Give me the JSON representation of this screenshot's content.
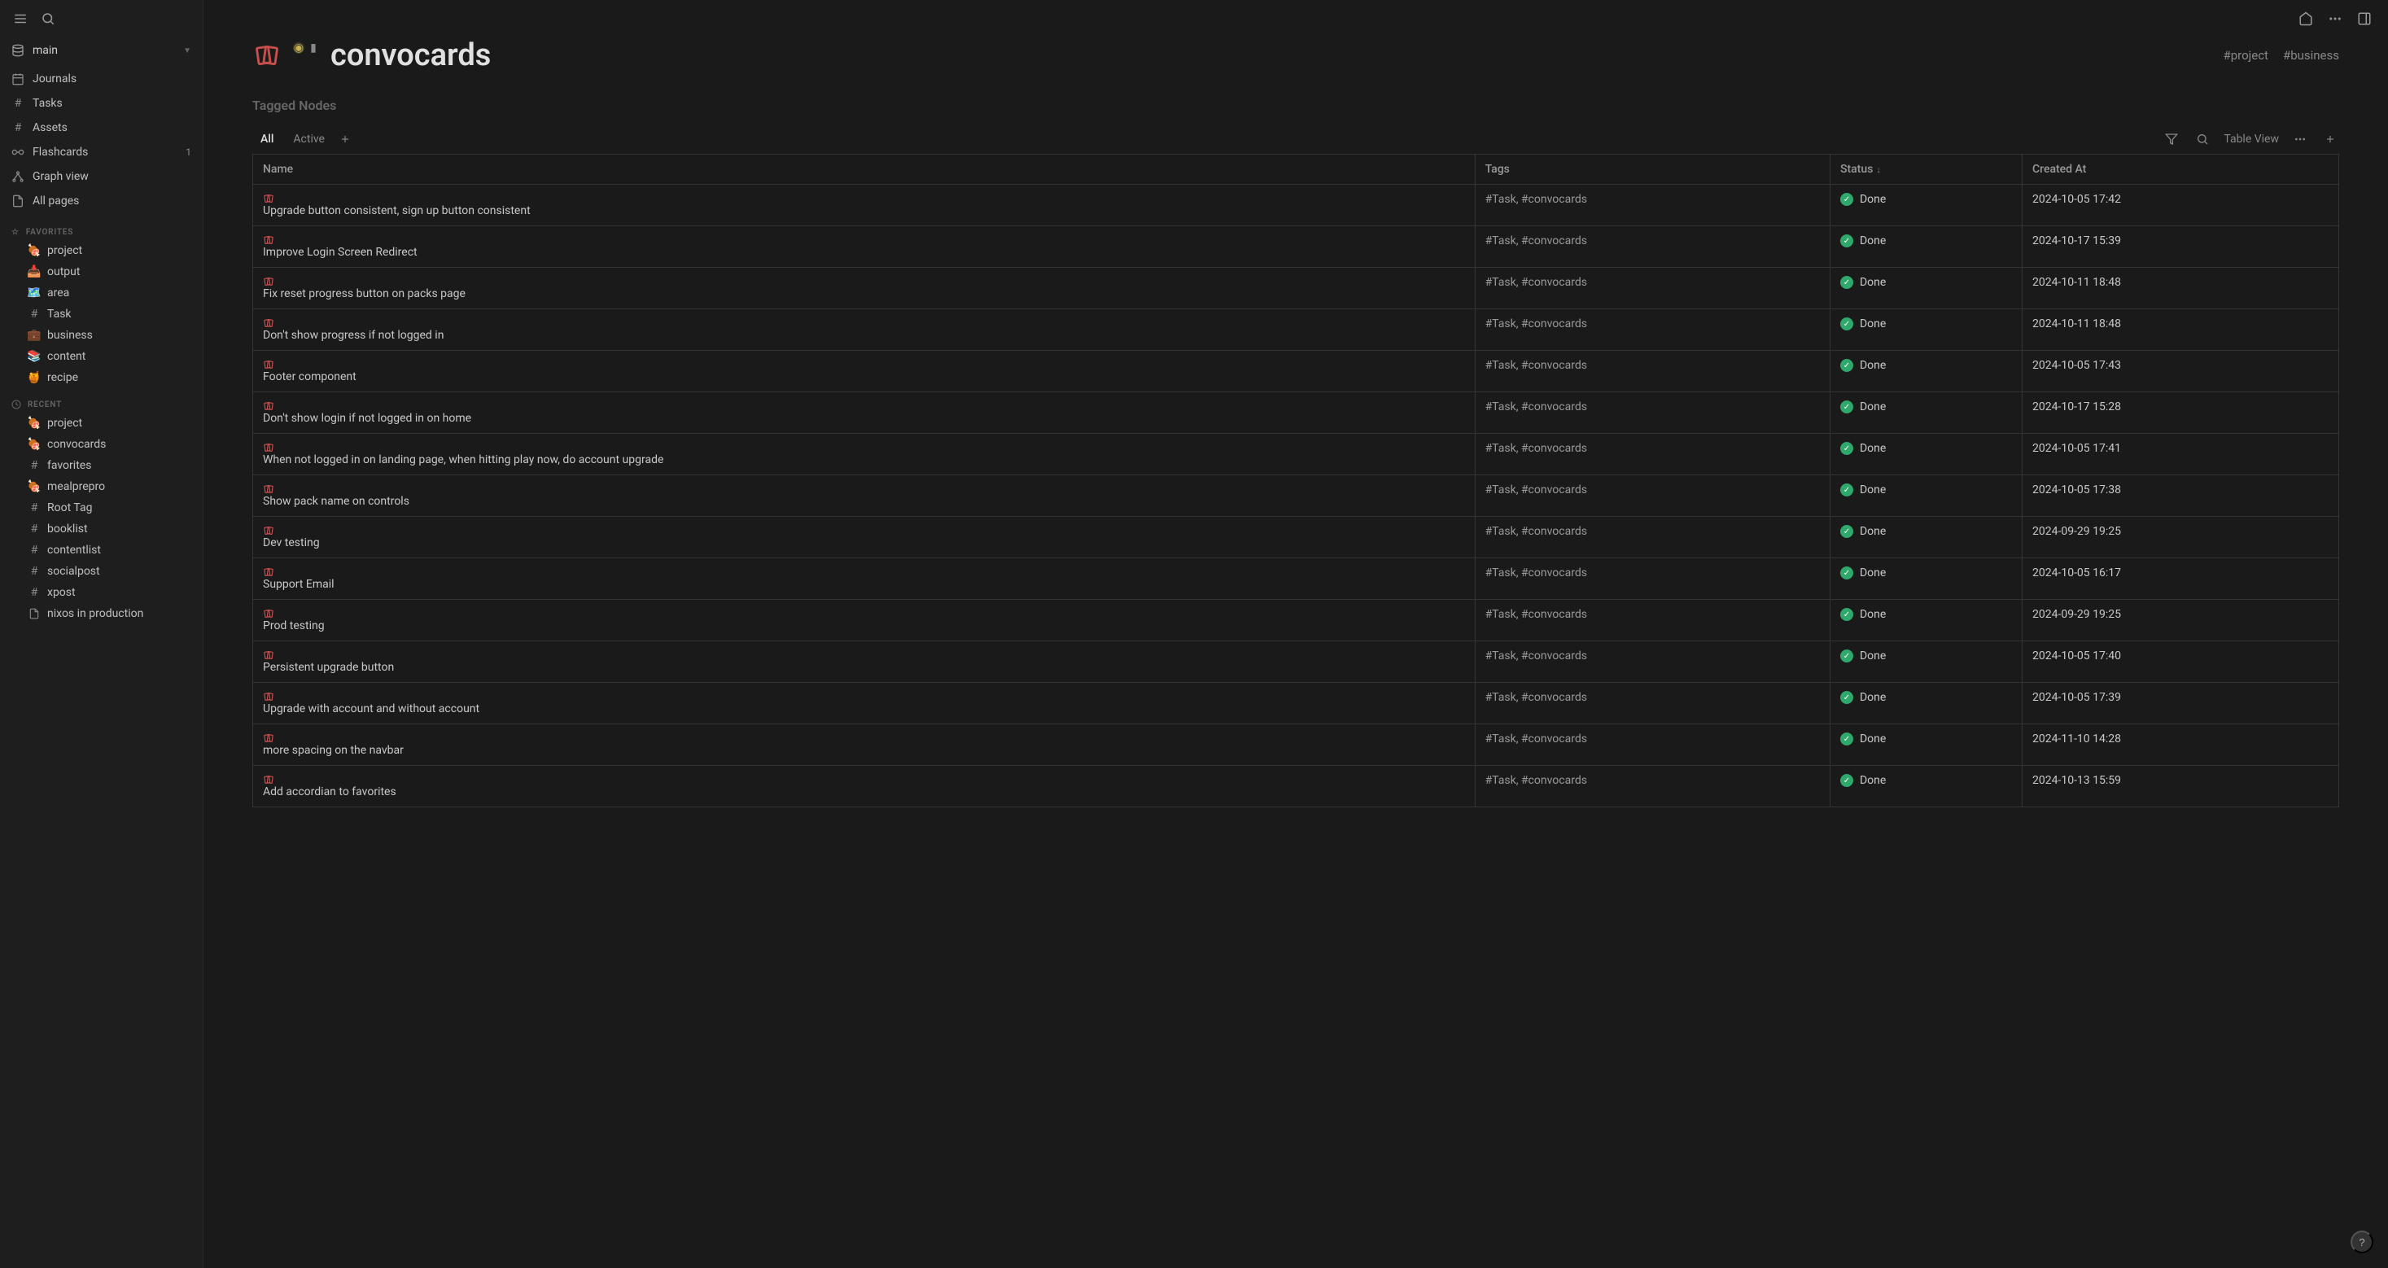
{
  "workspace": {
    "name": "main"
  },
  "nav": {
    "journals": "Journals",
    "tasks": "Tasks",
    "assets": "Assets",
    "flashcards": "Flashcards",
    "flashcards_count": "1",
    "graph": "Graph view",
    "all_pages": "All pages"
  },
  "favorites": {
    "label": "FAVORITES",
    "items": [
      {
        "icon": "meat",
        "label": "project"
      },
      {
        "icon": "inbox",
        "label": "output"
      },
      {
        "icon": "map",
        "label": "area"
      },
      {
        "icon": "hash",
        "label": "Task"
      },
      {
        "icon": "briefcase",
        "label": "business"
      },
      {
        "icon": "books",
        "label": "content"
      },
      {
        "icon": "honey",
        "label": "recipe"
      }
    ]
  },
  "recent": {
    "label": "RECENT",
    "items": [
      {
        "icon": "meat",
        "label": "project"
      },
      {
        "icon": "meat",
        "label": "convocards"
      },
      {
        "icon": "hash",
        "label": "favorites"
      },
      {
        "icon": "meat",
        "label": "mealprepro"
      },
      {
        "icon": "hash",
        "label": "Root Tag"
      },
      {
        "icon": "hash",
        "label": "booklist"
      },
      {
        "icon": "hash",
        "label": "contentlist"
      },
      {
        "icon": "hash",
        "label": "socialpost"
      },
      {
        "icon": "hash",
        "label": "xpost"
      },
      {
        "icon": "page",
        "label": "nixos in production"
      }
    ]
  },
  "page": {
    "title": "convocards",
    "tags": [
      "#project",
      "#business"
    ]
  },
  "tagged_nodes_label": "Tagged Nodes",
  "tabs": {
    "all": "All",
    "active": "Active"
  },
  "view_label": "Table View",
  "columns": {
    "name": "Name",
    "tags": "Tags",
    "status": "Status",
    "created": "Created At"
  },
  "rows": [
    {
      "name": "Upgrade button consistent, sign up button consistent",
      "tags": "#Task, #convocards",
      "status": "Done",
      "created": "2024-10-05 17:42"
    },
    {
      "name": "Improve Login Screen Redirect",
      "tags": "#Task, #convocards",
      "status": "Done",
      "created": "2024-10-17 15:39"
    },
    {
      "name": "Fix reset progress button on packs page",
      "tags": "#Task, #convocards",
      "status": "Done",
      "created": "2024-10-11 18:48"
    },
    {
      "name": "Don't show progress if not logged in",
      "tags": "#Task, #convocards",
      "status": "Done",
      "created": "2024-10-11 18:48"
    },
    {
      "name": "Footer component",
      "tags": "#Task, #convocards",
      "status": "Done",
      "created": "2024-10-05 17:43"
    },
    {
      "name": "Don't show login if not logged in on home",
      "tags": "#Task, #convocards",
      "status": "Done",
      "created": "2024-10-17 15:28"
    },
    {
      "name": "When not logged in on landing page, when hitting play now, do account upgrade",
      "tags": "#Task, #convocards",
      "status": "Done",
      "created": "2024-10-05 17:41"
    },
    {
      "name": "Show pack name on controls",
      "tags": "#Task, #convocards",
      "status": "Done",
      "created": "2024-10-05 17:38"
    },
    {
      "name": "Dev testing",
      "tags": "#Task, #convocards",
      "status": "Done",
      "created": "2024-09-29 19:25"
    },
    {
      "name": "Support Email",
      "tags": "#Task, #convocards",
      "status": "Done",
      "created": "2024-10-05 16:17"
    },
    {
      "name": "Prod testing",
      "tags": "#Task, #convocards",
      "status": "Done",
      "created": "2024-09-29 19:25"
    },
    {
      "name": "Persistent upgrade button",
      "tags": "#Task, #convocards",
      "status": "Done",
      "created": "2024-10-05 17:40"
    },
    {
      "name": "Upgrade with account and without account",
      "tags": "#Task, #convocards",
      "status": "Done",
      "created": "2024-10-05 17:39"
    },
    {
      "name": "more spacing on the navbar",
      "tags": "#Task, #convocards",
      "status": "Done",
      "created": "2024-11-10 14:28"
    },
    {
      "name": "Add accordian to favorites",
      "tags": "#Task, #convocards",
      "status": "Done",
      "created": "2024-10-13 15:59"
    }
  ]
}
